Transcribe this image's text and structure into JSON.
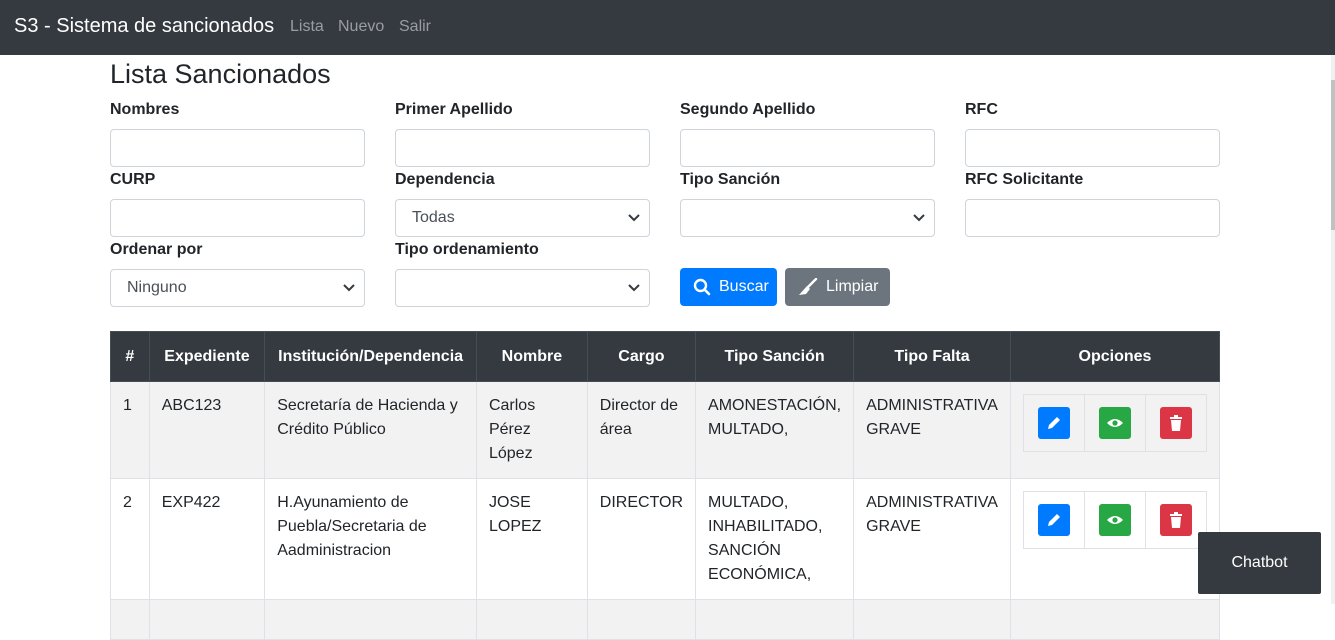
{
  "navbar": {
    "brand": "S3 - Sistema de sancionados",
    "links": [
      "Lista",
      "Nuevo",
      "Salir"
    ]
  },
  "page": {
    "title": "Lista Sancionados"
  },
  "filters": {
    "nombres": {
      "label": "Nombres",
      "value": ""
    },
    "primer_apellido": {
      "label": "Primer Apellido",
      "value": ""
    },
    "segundo_apellido": {
      "label": "Segundo Apellido",
      "value": ""
    },
    "rfc": {
      "label": "RFC",
      "value": ""
    },
    "curp": {
      "label": "CURP",
      "value": ""
    },
    "dependencia": {
      "label": "Dependencia",
      "selected": "Todas"
    },
    "tipo_sancion": {
      "label": "Tipo Sanción",
      "selected": ""
    },
    "rfc_solicitante": {
      "label": "RFC Solicitante",
      "value": ""
    },
    "ordenar_por": {
      "label": "Ordenar por",
      "selected": "Ninguno"
    },
    "tipo_ordenamiento": {
      "label": "Tipo ordenamiento",
      "selected": ""
    }
  },
  "buttons": {
    "buscar": "Buscar",
    "limpiar": "Limpiar"
  },
  "table": {
    "headers": [
      "#",
      "Expediente",
      "Institución/Dependencia",
      "Nombre",
      "Cargo",
      "Tipo Sanción",
      "Tipo Falta",
      "Opciones"
    ],
    "rows": [
      {
        "num": "1",
        "expediente": "ABC123",
        "institucion": [
          "Secretaría de Hacienda y",
          "Crédito Público"
        ],
        "nombre": [
          "Carlos Pérez",
          "López"
        ],
        "cargo": [
          "Director de",
          "área"
        ],
        "tipo_sancion": [
          "AMONESTACIÓN,",
          "MULTADO,"
        ],
        "tipo_falta": [
          "ADMINISTRATIVA",
          "GRAVE"
        ]
      },
      {
        "num": "2",
        "expediente": "EXP422",
        "institucion": [
          "H.Ayunamiento de",
          "Puebla/Secretaria de",
          "Aadministracion"
        ],
        "nombre": [
          "JOSE LOPEZ"
        ],
        "cargo": [
          "DIRECTOR"
        ],
        "tipo_sancion": [
          "MULTADO,",
          "INHABILITADO,",
          "SANCIÓN",
          "ECONÓMICA,"
        ],
        "tipo_falta": [
          "ADMINISTRATIVA",
          "GRAVE"
        ]
      }
    ]
  },
  "chatbot": {
    "label": "Chatbot"
  },
  "icons": {
    "edit": "pencil-icon",
    "view": "eye-icon",
    "delete": "trash-icon",
    "search": "search-icon",
    "clear": "broom-icon"
  },
  "colors": {
    "navbar": "#343a40",
    "primary": "#007bff",
    "secondary": "#6c757d",
    "success": "#28a745",
    "danger": "#dc3545"
  }
}
